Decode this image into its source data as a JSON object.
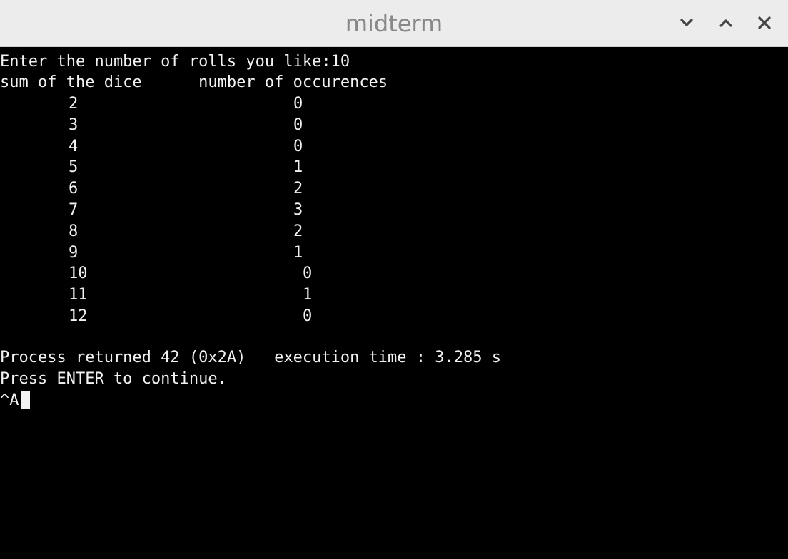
{
  "window": {
    "title": "midterm",
    "controls": {
      "minimize_icon": "chevron-down-icon",
      "maximize_icon": "chevron-up-icon",
      "close_icon": "close-icon"
    }
  },
  "terminal": {
    "prompt_line": "Enter the number of rolls you like:10",
    "header_line": "sum of the dice      number of occurences",
    "rows": [
      {
        "sum": "2",
        "count": "0"
      },
      {
        "sum": "3",
        "count": "0"
      },
      {
        "sum": "4",
        "count": "0"
      },
      {
        "sum": "5",
        "count": "1"
      },
      {
        "sum": "6",
        "count": "2"
      },
      {
        "sum": "7",
        "count": "3"
      },
      {
        "sum": "8",
        "count": "2"
      },
      {
        "sum": "9",
        "count": "1"
      },
      {
        "sum": "10",
        "count": "0"
      },
      {
        "sum": "11",
        "count": "1"
      },
      {
        "sum": "12",
        "count": "0"
      }
    ],
    "process_line": "Process returned 42 (0x2A)   execution time : 3.285 s",
    "press_line": "Press ENTER to continue.",
    "input_line": "^A"
  },
  "colors": {
    "titlebar_bg": "#ececec",
    "title_text": "#888888",
    "terminal_bg": "#000000",
    "terminal_text": "#f2f2f2"
  }
}
